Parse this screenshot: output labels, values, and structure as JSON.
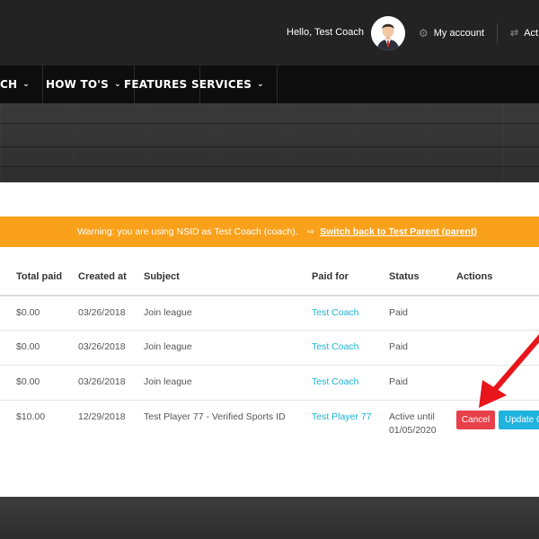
{
  "header": {
    "greeting": "Hello, Test Coach",
    "my_account": "My account",
    "activity": "Act"
  },
  "nav": {
    "items": [
      {
        "label": "CH"
      },
      {
        "label": "HOW TO'S"
      },
      {
        "label": "FEATURES"
      },
      {
        "label": "SERVICES"
      }
    ]
  },
  "warning": {
    "text": "Warning: you are using NSID as Test Coach (coach).",
    "link": "Switch back to Test Parent (parent)"
  },
  "table": {
    "columns": [
      "Total paid",
      "Created at",
      "Subject",
      "Paid for",
      "Status",
      "Actions"
    ],
    "rows": [
      {
        "total": "$0.00",
        "created": "03/26/2018",
        "subject": "Join league",
        "paid_for": "Test Coach",
        "status": "Paid"
      },
      {
        "total": "$0.00",
        "created": "03/26/2018",
        "subject": "Join league",
        "paid_for": "Test Coach",
        "status": "Paid"
      },
      {
        "total": "$0.00",
        "created": "03/26/2018",
        "subject": "Join league",
        "paid_for": "Test Coach",
        "status": "Paid"
      },
      {
        "total": "$10.00",
        "created": "12/29/2018",
        "subject": "Test Player 77 - Verified Sports ID",
        "paid_for": "Test Player 77",
        "status_line1": "Active until",
        "status_line2": "01/05/2020"
      }
    ],
    "actions": {
      "cancel": "Cancel",
      "update": "Update C"
    }
  },
  "colors": {
    "warning_bg": "#f9a11b",
    "link": "#19b3d6",
    "cancel": "#e8404a",
    "update": "#1fb3de",
    "arrow": "#e8151b"
  }
}
